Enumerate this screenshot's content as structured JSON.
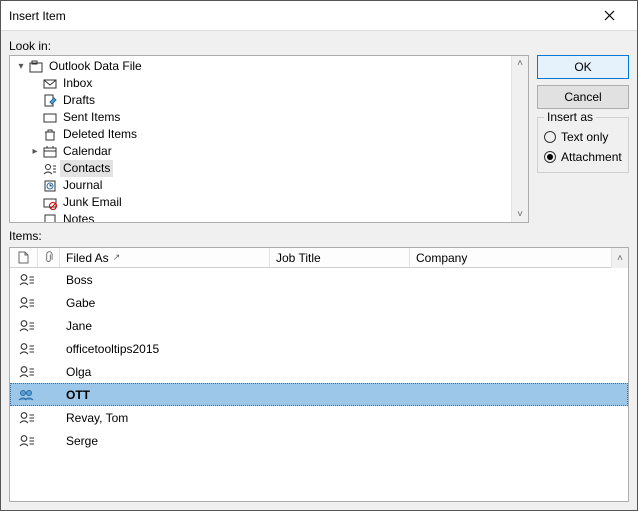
{
  "window": {
    "title": "Insert Item"
  },
  "labels": {
    "look_in": "Look in:",
    "items": "Items:"
  },
  "buttons": {
    "ok": "OK",
    "cancel": "Cancel"
  },
  "insert_as": {
    "legend": "Insert as",
    "text_only": "Text only",
    "attachment": "Attachment",
    "selected": "attachment"
  },
  "tree": {
    "root": "Outlook Data File",
    "nodes": [
      {
        "label": "Inbox"
      },
      {
        "label": "Drafts"
      },
      {
        "label": "Sent Items"
      },
      {
        "label": "Deleted Items"
      },
      {
        "label": "Calendar",
        "expandable": true
      },
      {
        "label": "Contacts",
        "selected": true
      },
      {
        "label": "Journal"
      },
      {
        "label": "Junk Email"
      },
      {
        "label": "Notes"
      }
    ]
  },
  "columns": {
    "filed_as": "Filed As",
    "job_title": "Job Title",
    "company": "Company"
  },
  "items": [
    {
      "type": "contact",
      "filed_as": "Boss"
    },
    {
      "type": "contact",
      "filed_as": "Gabe"
    },
    {
      "type": "contact",
      "filed_as": "Jane"
    },
    {
      "type": "contact",
      "filed_as": "officetooltips2015"
    },
    {
      "type": "contact",
      "filed_as": "Olga"
    },
    {
      "type": "dl",
      "filed_as": "OTT",
      "selected": true
    },
    {
      "type": "contact",
      "filed_as": "Revay, Tom"
    },
    {
      "type": "contact",
      "filed_as": "Serge"
    }
  ]
}
